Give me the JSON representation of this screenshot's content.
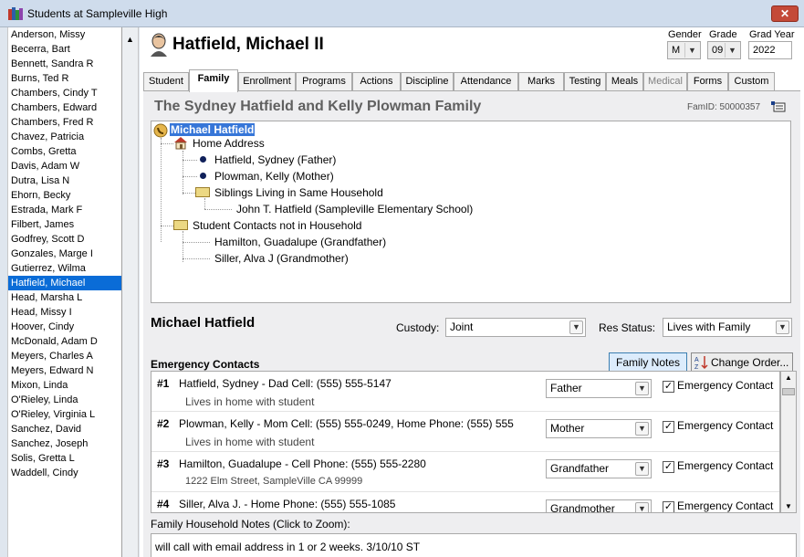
{
  "window": {
    "title": "Students at Sampleville High",
    "close_icon": "close-icon"
  },
  "student_list": [
    "Anderson, Missy",
    "Becerra, Bart",
    "Bennett, Sandra R",
    "Burns, Ted R",
    "Chambers, Cindy T",
    "Chambers, Edward",
    "Chambers, Fred R",
    "Chavez, Patricia",
    "Combs, Gretta",
    "Davis, Adam W",
    "Dutra, Lisa N",
    "Ehorn, Becky",
    "Estrada, Mark F",
    "Filbert, James",
    "Godfrey, Scott D",
    "Gonzales, Marge I",
    "Gutierrez, Wilma",
    "Hatfield, Michael",
    "Head, Marsha L",
    "Head, Missy I",
    "Hoover, Cindy",
    "McDonald, Adam D",
    "Meyers, Charles A",
    "Meyers, Edward N",
    "Mixon, Linda",
    "O'Rieley, Linda",
    "O'Rieley, Virginia L",
    "Sanchez, David",
    "Sanchez, Joseph",
    "Solis, Gretta L",
    "Waddell, Cindy"
  ],
  "selected_student_index": 17,
  "header": {
    "student_name": "Hatfield, Michael II",
    "gender_label": "Gender",
    "gender_value": "M",
    "grade_label": "Grade",
    "grade_value": "09",
    "gradyear_label": "Grad Year",
    "gradyear_value": "2022"
  },
  "tabs": [
    {
      "label": "Student"
    },
    {
      "label": "Family"
    },
    {
      "label": "Enrollment"
    },
    {
      "label": "Programs"
    },
    {
      "label": "Actions"
    },
    {
      "label": "Discipline"
    },
    {
      "label": "Attendance"
    },
    {
      "label": "Marks"
    },
    {
      "label": "Testing"
    },
    {
      "label": "Meals"
    },
    {
      "label": "Medical"
    },
    {
      "label": "Forms"
    },
    {
      "label": "Custom"
    }
  ],
  "active_tab": "Family",
  "family": {
    "title": "The Sydney Hatfield and Kelly Plowman Family",
    "famid": "FamID: 50000357",
    "tree": {
      "root": "Michael Hatfield",
      "home_address": "Home Address",
      "parent1": "Hatfield, Sydney (Father)",
      "parent2": "Plowman, Kelly (Mother)",
      "siblings_folder": "Siblings Living in Same Household",
      "sibling1": "John T. Hatfield  (Sampleville Elementary School)",
      "contacts_folder": "Student Contacts not in Household",
      "contact1": "Hamilton, Guadalupe (Grandfather)",
      "contact2": "Siller, Alva J (Grandmother)"
    }
  },
  "detail": {
    "name": "Michael Hatfield",
    "custody_label": "Custody:",
    "custody_value": "Joint",
    "res_status_label": "Res Status:",
    "res_status_value": "Lives with Family"
  },
  "emergency": {
    "heading": "Emergency Contacts",
    "family_notes_button": "Family Notes",
    "change_order_button": "Change Order...",
    "emergency_label": "Emergency Contact",
    "contacts": [
      {
        "num": "#1",
        "text": "Hatfield, Sydney - Dad Cell: (555) 555-5147",
        "sub": "Lives in home with student",
        "relation": "Father",
        "checked": "✓"
      },
      {
        "num": "#2",
        "text": "Plowman, Kelly - Mom Cell: (555) 555-0249, Home Phone: (555) 555",
        "sub": "Lives in home with student",
        "relation": "Mother",
        "checked": "✓"
      },
      {
        "num": "#3",
        "text": "Hamilton, Guadalupe - Cell Phone: (555) 555-2280",
        "sub": "1222 Elm Street, SampleVille CA 99999",
        "relation": "Grandfather",
        "checked": "✓"
      },
      {
        "num": "#4",
        "text": "Siller, Alva J. - Home Phone: (555) 555-1085",
        "sub": "",
        "relation": "Grandmother",
        "checked": "✓"
      }
    ]
  },
  "notes": {
    "label": "Family Household Notes (Click to Zoom):",
    "value": "will call with email address in 1 or 2 weeks. 3/10/10 ST"
  }
}
